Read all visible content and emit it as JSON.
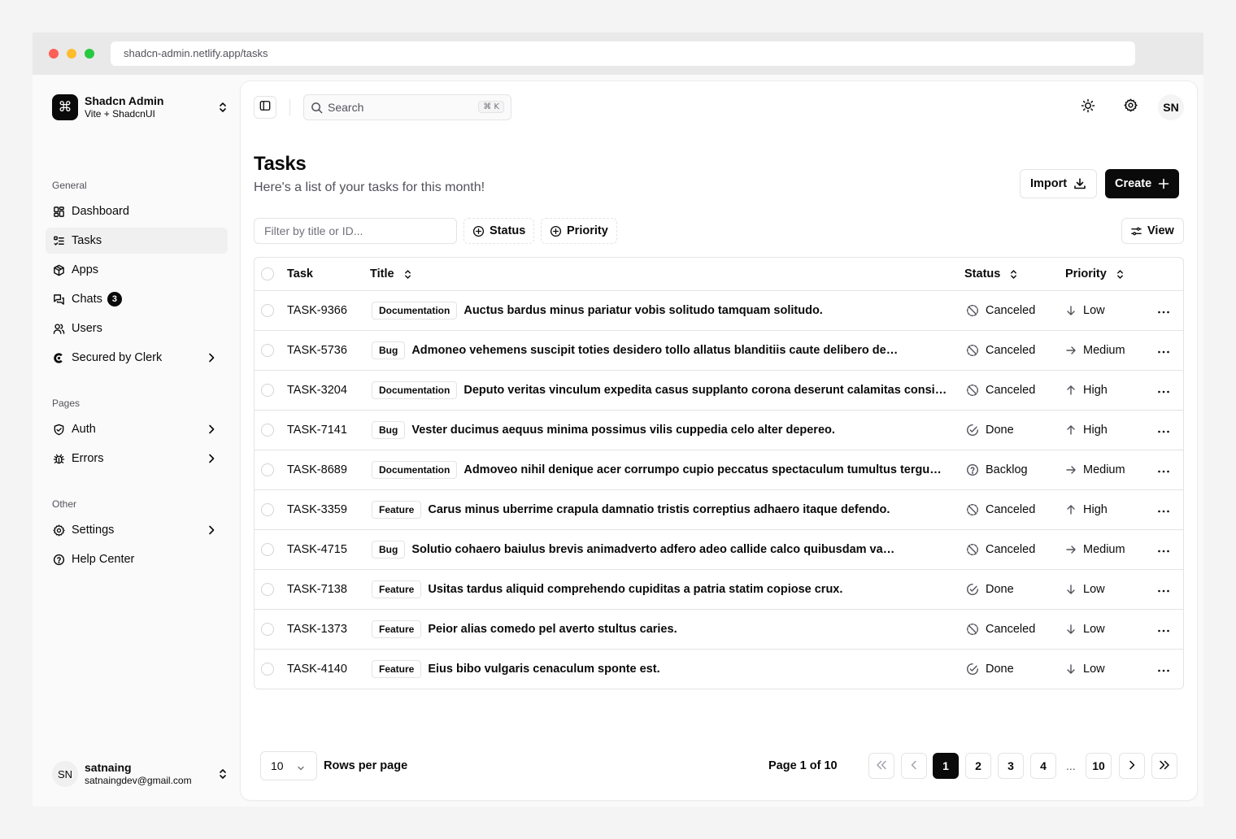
{
  "browser": {
    "url": "shadcn-admin.netlify.app/tasks"
  },
  "team": {
    "name": "Shadcn Admin",
    "plan": "Vite + ShadcnUI",
    "logo_glyph": "⌘"
  },
  "sidebar": {
    "groups": [
      {
        "label": "General"
      },
      {
        "label": "Pages"
      },
      {
        "label": "Other"
      }
    ],
    "items": [
      {
        "label": "Dashboard",
        "icon": "layout-dashboard-icon"
      },
      {
        "label": "Tasks",
        "icon": "list-todo-icon",
        "active": true
      },
      {
        "label": "Apps",
        "icon": "package-icon"
      },
      {
        "label": "Chats",
        "icon": "messages-icon",
        "badge": "3"
      },
      {
        "label": "Users",
        "icon": "users-icon"
      },
      {
        "label": "Secured by Clerk",
        "icon": "clerk-icon"
      },
      {
        "label": "Auth",
        "icon": "shield-check-icon"
      },
      {
        "label": "Errors",
        "icon": "bug-icon"
      },
      {
        "label": "Settings",
        "icon": "gear-icon"
      },
      {
        "label": "Help Center",
        "icon": "help-circle-icon"
      }
    ]
  },
  "user": {
    "initials": "SN",
    "name": "satnaing",
    "email": "satnaingdev@gmail.com"
  },
  "header": {
    "search_placeholder": "Search",
    "search_shortcut": "⌘ K",
    "avatar_initials": "SN"
  },
  "page": {
    "title": "Tasks",
    "subtitle": "Here's a list of your tasks for this month!",
    "import_label": "Import",
    "create_label": "Create"
  },
  "toolbar": {
    "filter_placeholder": "Filter by title or ID...",
    "status_label": "Status",
    "priority_label": "Priority",
    "view_label": "View"
  },
  "table": {
    "columns": {
      "task": "Task",
      "title": "Title",
      "status": "Status",
      "priority": "Priority"
    },
    "rows": [
      {
        "id": "TASK-9366",
        "label": "Documentation",
        "title": "Auctus bardus minus pariatur vobis solitudo tamquam solitudo.",
        "status": "Canceled",
        "priority": "Low"
      },
      {
        "id": "TASK-5736",
        "label": "Bug",
        "title": "Admoneo vehemens suscipit toties desidero tollo allatus blanditiis caute delibero degenero.",
        "status": "Canceled",
        "priority": "Medium"
      },
      {
        "id": "TASK-3204",
        "label": "Documentation",
        "title": "Deputo veritas vinculum expedita casus supplanto corona deserunt calamitas consider...",
        "status": "Canceled",
        "priority": "High"
      },
      {
        "id": "TASK-7141",
        "label": "Bug",
        "title": "Vester ducimus aequus minima possimus vilis cuppedia celo alter depereo.",
        "status": "Done",
        "priority": "High"
      },
      {
        "id": "TASK-8689",
        "label": "Documentation",
        "title": "Admoveo nihil denique acer corrumpo cupio peccatus spectaculum tumultus tergum c...",
        "status": "Backlog",
        "priority": "Medium"
      },
      {
        "id": "TASK-3359",
        "label": "Feature",
        "title": "Carus minus uberrime crapula damnatio tristis correptius adhaero itaque defendo.",
        "status": "Canceled",
        "priority": "High"
      },
      {
        "id": "TASK-4715",
        "label": "Bug",
        "title": "Solutio cohaero baiulus brevis animadverto adfero adeo callide calco quibusdam vapulus tergum.",
        "status": "Canceled",
        "priority": "Medium"
      },
      {
        "id": "TASK-7138",
        "label": "Feature",
        "title": "Usitas tardus aliquid comprehendo cupiditas a patria statim copiose crux.",
        "status": "Done",
        "priority": "Low"
      },
      {
        "id": "TASK-1373",
        "label": "Feature",
        "title": "Peior alias comedo pel averto stultus caries.",
        "status": "Canceled",
        "priority": "Low"
      },
      {
        "id": "TASK-4140",
        "label": "Feature",
        "title": "Eius bibo vulgaris cenaculum sponte est.",
        "status": "Done",
        "priority": "Low"
      }
    ]
  },
  "pagination": {
    "rows_per_page_value": "10",
    "rows_per_page_label": "Rows per page",
    "page_info": "Page 1 of 10",
    "pages": [
      "1",
      "2",
      "3",
      "4",
      "10"
    ],
    "ellipsis": "...",
    "current_page": "1"
  }
}
